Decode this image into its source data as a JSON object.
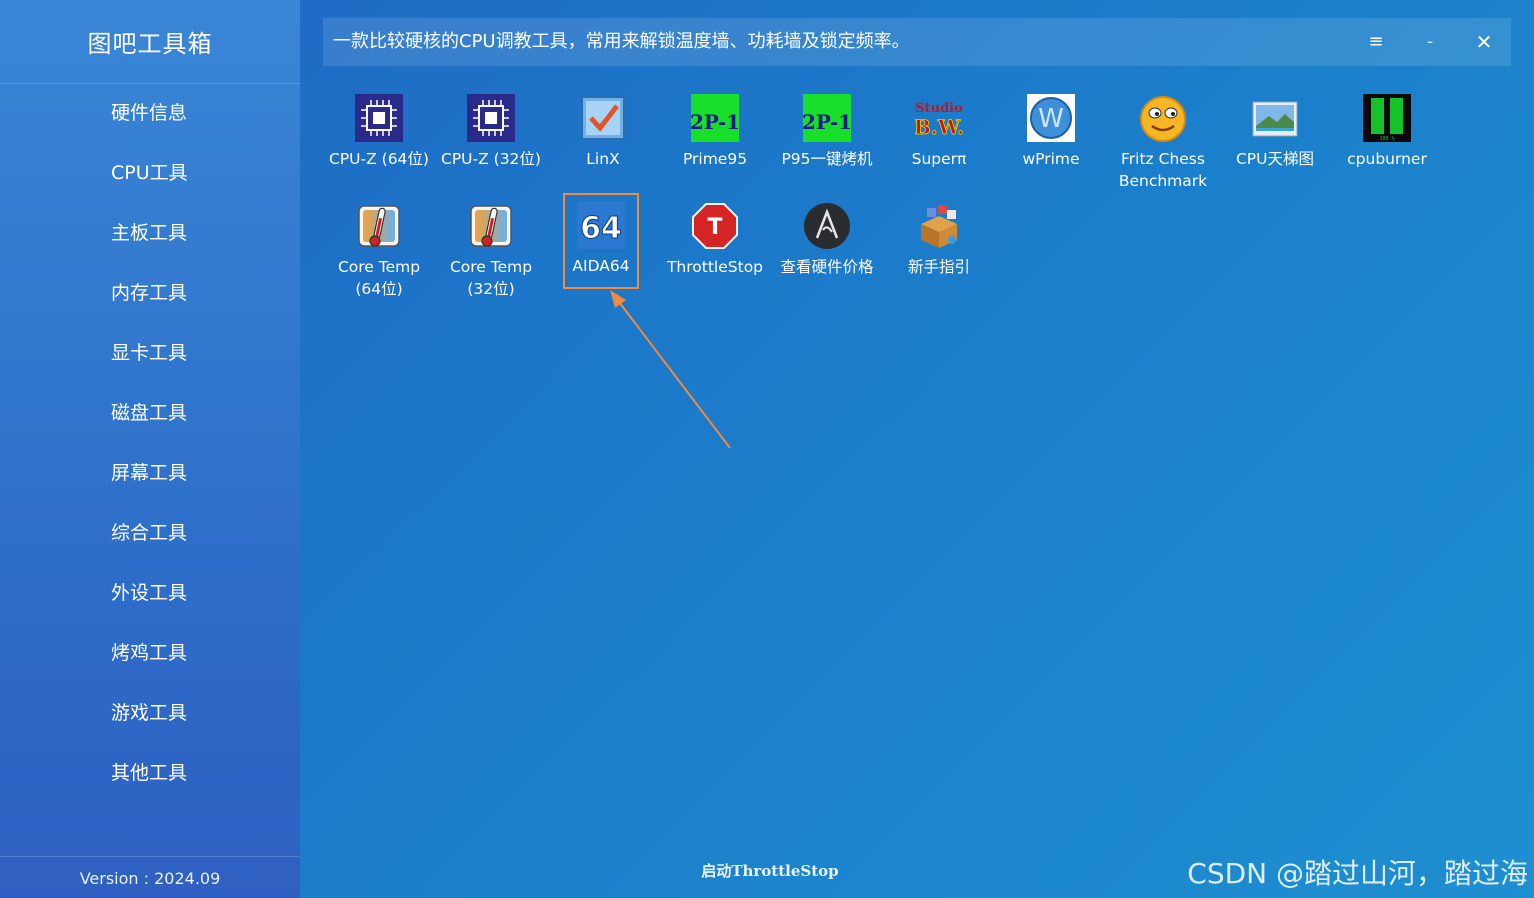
{
  "sidebar": {
    "title": "图吧工具箱",
    "items": [
      {
        "label": "硬件信息"
      },
      {
        "label": "CPU工具"
      },
      {
        "label": "主板工具"
      },
      {
        "label": "内存工具"
      },
      {
        "label": "显卡工具"
      },
      {
        "label": "磁盘工具"
      },
      {
        "label": "屏幕工具"
      },
      {
        "label": "综合工具"
      },
      {
        "label": "外设工具"
      },
      {
        "label": "烤鸡工具"
      },
      {
        "label": "游戏工具"
      },
      {
        "label": "其他工具"
      }
    ],
    "version": "Version : 2024.09"
  },
  "header": {
    "description": "一款比较硬核的CPU调教工具，常用来解锁温度墙、功耗墙及锁定频率。",
    "menu_icon": "≡",
    "minimize_icon": "-",
    "close_icon": "✕"
  },
  "tools": [
    {
      "label": "CPU-Z (64位)",
      "icon": "cpuz-icon"
    },
    {
      "label": "CPU-Z (32位)",
      "icon": "cpuz-icon"
    },
    {
      "label": "LinX",
      "icon": "linx-icon"
    },
    {
      "label": "Prime95",
      "icon": "prime95-icon",
      "glyph": "2P-1"
    },
    {
      "label": "P95一键烤机",
      "icon": "prime95-icon",
      "glyph": "2P-1"
    },
    {
      "label": "Superπ",
      "icon": "superpi-icon",
      "glyph": "B.W."
    },
    {
      "label": "wPrime",
      "icon": "wprime-icon",
      "glyph": "W"
    },
    {
      "label": "Fritz Chess Benchmark",
      "icon": "fritz-icon"
    },
    {
      "label": "CPU天梯图",
      "icon": "picture-icon"
    },
    {
      "label": "cpuburner",
      "icon": "cpuburner-icon"
    },
    {
      "label": "Core Temp (64位)",
      "icon": "thermometer-icon"
    },
    {
      "label": "Core Temp (32位)",
      "icon": "thermometer-icon"
    },
    {
      "label": "AIDA64",
      "icon": "aida64-icon",
      "glyph": "64",
      "selected": true
    },
    {
      "label": "ThrottleStop",
      "icon": "throttlestop-icon",
      "glyph": "T"
    },
    {
      "label": "查看硬件价格",
      "icon": "price-icon"
    },
    {
      "label": "新手指引",
      "icon": "guide-box-icon"
    }
  ],
  "status": "启动ThrottleStop",
  "watermark": "CSDN @踏过山河，踏过海",
  "colors": {
    "accent": "#f08a3c",
    "sidebar": "#3a86d6",
    "background": "#1b7fcb"
  }
}
